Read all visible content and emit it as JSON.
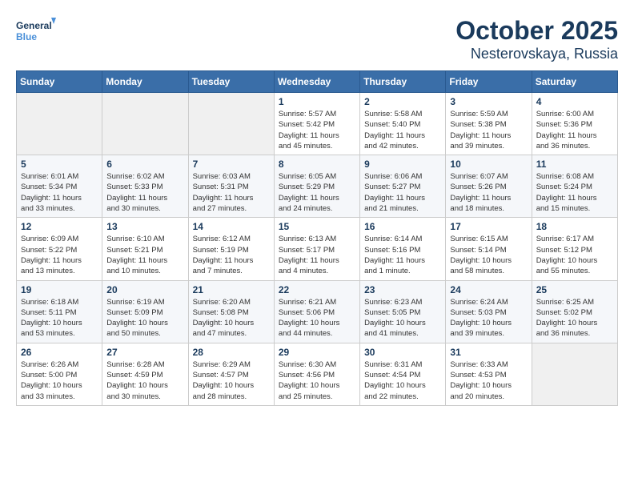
{
  "header": {
    "logo_line1": "General",
    "logo_line2": "Blue",
    "title": "October 2025",
    "subtitle": "Nesterovskaya, Russia"
  },
  "weekdays": [
    "Sunday",
    "Monday",
    "Tuesday",
    "Wednesday",
    "Thursday",
    "Friday",
    "Saturday"
  ],
  "weeks": [
    [
      {
        "day": "",
        "info": ""
      },
      {
        "day": "",
        "info": ""
      },
      {
        "day": "",
        "info": ""
      },
      {
        "day": "1",
        "info": "Sunrise: 5:57 AM\nSunset: 5:42 PM\nDaylight: 11 hours\nand 45 minutes."
      },
      {
        "day": "2",
        "info": "Sunrise: 5:58 AM\nSunset: 5:40 PM\nDaylight: 11 hours\nand 42 minutes."
      },
      {
        "day": "3",
        "info": "Sunrise: 5:59 AM\nSunset: 5:38 PM\nDaylight: 11 hours\nand 39 minutes."
      },
      {
        "day": "4",
        "info": "Sunrise: 6:00 AM\nSunset: 5:36 PM\nDaylight: 11 hours\nand 36 minutes."
      }
    ],
    [
      {
        "day": "5",
        "info": "Sunrise: 6:01 AM\nSunset: 5:34 PM\nDaylight: 11 hours\nand 33 minutes."
      },
      {
        "day": "6",
        "info": "Sunrise: 6:02 AM\nSunset: 5:33 PM\nDaylight: 11 hours\nand 30 minutes."
      },
      {
        "day": "7",
        "info": "Sunrise: 6:03 AM\nSunset: 5:31 PM\nDaylight: 11 hours\nand 27 minutes."
      },
      {
        "day": "8",
        "info": "Sunrise: 6:05 AM\nSunset: 5:29 PM\nDaylight: 11 hours\nand 24 minutes."
      },
      {
        "day": "9",
        "info": "Sunrise: 6:06 AM\nSunset: 5:27 PM\nDaylight: 11 hours\nand 21 minutes."
      },
      {
        "day": "10",
        "info": "Sunrise: 6:07 AM\nSunset: 5:26 PM\nDaylight: 11 hours\nand 18 minutes."
      },
      {
        "day": "11",
        "info": "Sunrise: 6:08 AM\nSunset: 5:24 PM\nDaylight: 11 hours\nand 15 minutes."
      }
    ],
    [
      {
        "day": "12",
        "info": "Sunrise: 6:09 AM\nSunset: 5:22 PM\nDaylight: 11 hours\nand 13 minutes."
      },
      {
        "day": "13",
        "info": "Sunrise: 6:10 AM\nSunset: 5:21 PM\nDaylight: 11 hours\nand 10 minutes."
      },
      {
        "day": "14",
        "info": "Sunrise: 6:12 AM\nSunset: 5:19 PM\nDaylight: 11 hours\nand 7 minutes."
      },
      {
        "day": "15",
        "info": "Sunrise: 6:13 AM\nSunset: 5:17 PM\nDaylight: 11 hours\nand 4 minutes."
      },
      {
        "day": "16",
        "info": "Sunrise: 6:14 AM\nSunset: 5:16 PM\nDaylight: 11 hours\nand 1 minute."
      },
      {
        "day": "17",
        "info": "Sunrise: 6:15 AM\nSunset: 5:14 PM\nDaylight: 10 hours\nand 58 minutes."
      },
      {
        "day": "18",
        "info": "Sunrise: 6:17 AM\nSunset: 5:12 PM\nDaylight: 10 hours\nand 55 minutes."
      }
    ],
    [
      {
        "day": "19",
        "info": "Sunrise: 6:18 AM\nSunset: 5:11 PM\nDaylight: 10 hours\nand 53 minutes."
      },
      {
        "day": "20",
        "info": "Sunrise: 6:19 AM\nSunset: 5:09 PM\nDaylight: 10 hours\nand 50 minutes."
      },
      {
        "day": "21",
        "info": "Sunrise: 6:20 AM\nSunset: 5:08 PM\nDaylight: 10 hours\nand 47 minutes."
      },
      {
        "day": "22",
        "info": "Sunrise: 6:21 AM\nSunset: 5:06 PM\nDaylight: 10 hours\nand 44 minutes."
      },
      {
        "day": "23",
        "info": "Sunrise: 6:23 AM\nSunset: 5:05 PM\nDaylight: 10 hours\nand 41 minutes."
      },
      {
        "day": "24",
        "info": "Sunrise: 6:24 AM\nSunset: 5:03 PM\nDaylight: 10 hours\nand 39 minutes."
      },
      {
        "day": "25",
        "info": "Sunrise: 6:25 AM\nSunset: 5:02 PM\nDaylight: 10 hours\nand 36 minutes."
      }
    ],
    [
      {
        "day": "26",
        "info": "Sunrise: 6:26 AM\nSunset: 5:00 PM\nDaylight: 10 hours\nand 33 minutes."
      },
      {
        "day": "27",
        "info": "Sunrise: 6:28 AM\nSunset: 4:59 PM\nDaylight: 10 hours\nand 30 minutes."
      },
      {
        "day": "28",
        "info": "Sunrise: 6:29 AM\nSunset: 4:57 PM\nDaylight: 10 hours\nand 28 minutes."
      },
      {
        "day": "29",
        "info": "Sunrise: 6:30 AM\nSunset: 4:56 PM\nDaylight: 10 hours\nand 25 minutes."
      },
      {
        "day": "30",
        "info": "Sunrise: 6:31 AM\nSunset: 4:54 PM\nDaylight: 10 hours\nand 22 minutes."
      },
      {
        "day": "31",
        "info": "Sunrise: 6:33 AM\nSunset: 4:53 PM\nDaylight: 10 hours\nand 20 minutes."
      },
      {
        "day": "",
        "info": ""
      }
    ]
  ],
  "colors": {
    "header_bg": "#3a6ea8",
    "header_text": "#ffffff",
    "title_color": "#1a3a5c",
    "logo_blue": "#4a90d9"
  }
}
